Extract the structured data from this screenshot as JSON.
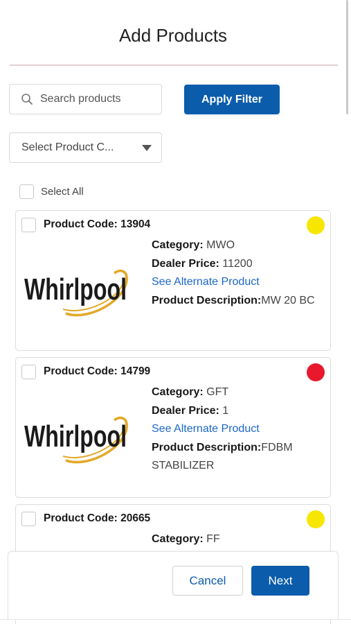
{
  "header": {
    "title": "Add Products"
  },
  "filters": {
    "search_placeholder": "Search products",
    "apply_label": "Apply Filter",
    "category_select_value": "Select Product C...",
    "select_all_label": "Select All"
  },
  "products": [
    {
      "code_label": "Product Code: 13904",
      "status_color": "#f7e600",
      "brand": "Whirlpool",
      "category_label": "Category:",
      "category": " MWO",
      "price_label": "Dealer Price:",
      "price": " 11200",
      "alt_link": "See Alternate Product",
      "desc_label": "Product Description:",
      "desc": "MW 20 BC"
    },
    {
      "code_label": "Product Code: 14799",
      "status_color": "#e8192c",
      "brand": "Whirlpool",
      "category_label": "Category:",
      "category": " GFT",
      "price_label": "Dealer Price:",
      "price": " 1",
      "alt_link": "See Alternate Product",
      "desc_label": "Product Description:",
      "desc": "FDBM STABILIZER"
    },
    {
      "code_label": "Product Code: 20665",
      "status_color": "#f7e600",
      "category_label": "Category:",
      "category": " FF"
    }
  ],
  "footer": {
    "cancel_label": "Cancel",
    "next_label": "Next"
  }
}
